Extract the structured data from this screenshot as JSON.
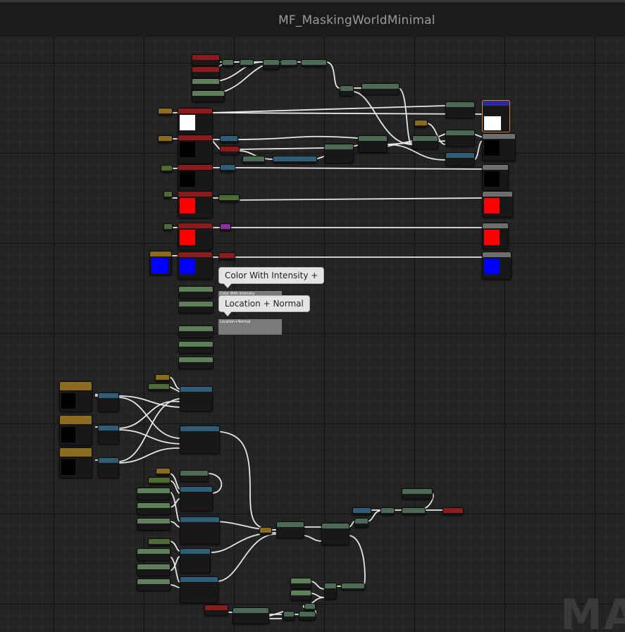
{
  "window": {
    "title": "MF_MaskingWorldMinimal"
  },
  "tooltips": {
    "color_with_intensity": "Color With Intensity +",
    "location_normal": "Location + Normal"
  },
  "comments": {
    "color_with_intensity": "Color With Intensity",
    "location_normal": "Location+Normal"
  },
  "watermark": "MAT",
  "colors": {
    "grid_bg": "#232323",
    "input_header": "#8a1c1c",
    "output_header": "#6e6e6e",
    "function_header": "#2f5f78",
    "constant_header": "#4d6b32",
    "texture_header": "#8c6a1e",
    "parameter_header": "#5f7f5a",
    "math_header": "#4d6a57",
    "wire": "#e6e6e6"
  }
}
